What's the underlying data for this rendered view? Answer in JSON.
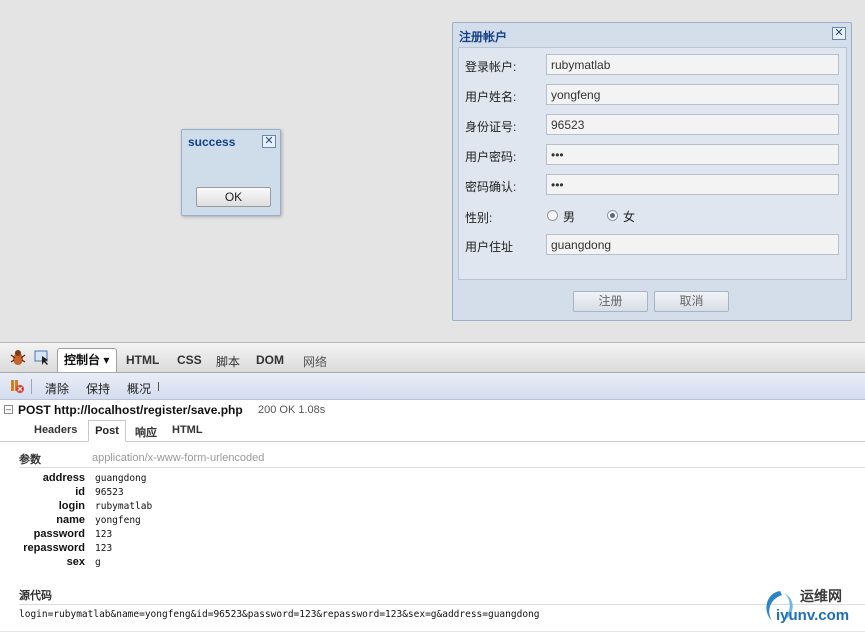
{
  "success_dialog": {
    "title": "success",
    "ok_label": "OK"
  },
  "register_dialog": {
    "title": "注册帐户",
    "fields": [
      {
        "label": "登录帐户:",
        "value": "rubymatlab"
      },
      {
        "label": "用户姓名:",
        "value": "yongfeng"
      },
      {
        "label": "身份证号:",
        "value": "96523"
      },
      {
        "label": "用户密码:",
        "value": "•••"
      },
      {
        "label": "密码确认:",
        "value": "•••"
      }
    ],
    "gender": {
      "label": "性别:",
      "male": "男",
      "female": "女",
      "selected": "female"
    },
    "address": {
      "label": "用户住址",
      "value": "guangdong"
    },
    "submit_label": "注册",
    "cancel_label": "取消"
  },
  "firebug": {
    "tabs": {
      "console": "控制台",
      "html": "HTML",
      "css": "CSS",
      "script": "脚本",
      "dom": "DOM",
      "net": "网络"
    },
    "toolbar": {
      "clear": "清除",
      "persist": "保持",
      "profile": "概况"
    },
    "request": {
      "method_url": "POST http://localhost/register/save.php",
      "status": "200 OK 1.08s"
    },
    "subtabs": {
      "headers": "Headers",
      "post": "Post",
      "response": "响应",
      "html": "HTML"
    },
    "params": {
      "heading": "参数",
      "content_type": "application/x-www-form-urlencoded",
      "rows": [
        {
          "key": "address",
          "value": "guangdong"
        },
        {
          "key": "id",
          "value": "96523"
        },
        {
          "key": "login",
          "value": "rubymatlab"
        },
        {
          "key": "name",
          "value": "yongfeng"
        },
        {
          "key": "password",
          "value": "123"
        },
        {
          "key": "repassword",
          "value": "123"
        },
        {
          "key": "sex",
          "value": "g"
        }
      ]
    },
    "source": {
      "heading": "源代码",
      "text": "login=rubymatlab&name=yongfeng&id=96523&password=123&repassword=123&sex=g&address=guangdong"
    }
  },
  "watermark": {
    "text1": "运维网",
    "text2": "iyunv.com"
  },
  "colors": {
    "dialog_title": "#15428b",
    "toolbar_blue": "#d4ddef"
  }
}
